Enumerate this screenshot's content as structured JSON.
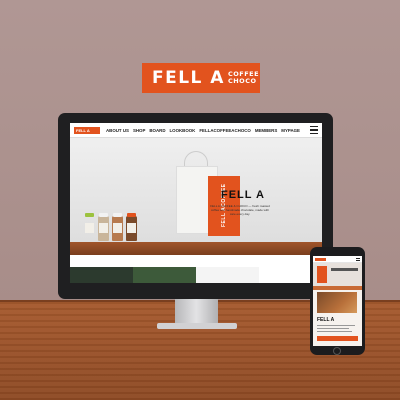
{
  "colors": {
    "brand": "#e2531e",
    "wall": "#a88e8a",
    "floor": "#9a5228",
    "bezel": "#1f1f21"
  },
  "logo": {
    "main": "FELL A",
    "line1": "COFFEE",
    "line2": "CHOCO"
  },
  "website": {
    "brand": "FELL A",
    "nav": [
      "ABOUT US",
      "SHOP",
      "BOARD",
      "LOOKBOOK",
      "FELLACOFFEEACHOCO",
      "MEMBERS",
      "MYPAGE"
    ],
    "menu_icon": "hamburger-icon",
    "hero": {
      "title": "FELL A",
      "copy": "FELL A COFFEE & CHOCO — fresh roasted coffee and handmade chocolate, made with care every day.",
      "bag_text": "FELL ACOFFEE"
    }
  },
  "mobile": {
    "title": "FELL A"
  }
}
